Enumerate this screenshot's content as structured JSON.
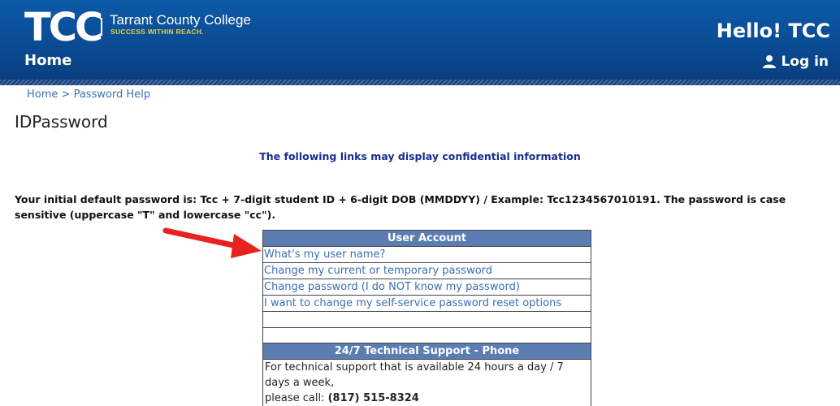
{
  "header": {
    "logo_text": "TCC",
    "college_name": "Tarrant County College",
    "tagline": "SUCCESS WITHIN REACH.",
    "home_label": "Home",
    "greeting": "Hello! TCC",
    "login_label": "Log in"
  },
  "breadcrumb": {
    "home": "Home",
    "separator": ">",
    "current": "Password Help"
  },
  "page_title": "IDPassword",
  "notice": "The following links may display confidential information",
  "password_info": "Your initial default password is: Tcc + 7-digit student ID + 6-digit DOB (MMDDYY) / Example: Tcc1234567010191. The password is case sensitive (uppercase \"T\" and lowercase \"cc\").",
  "user_account": {
    "title": "User Account",
    "links": [
      "What's my user name?",
      "Change my current or temporary password",
      "Change password (I do NOT know my password)",
      "I want to change my self-service password reset options"
    ]
  },
  "support": {
    "title": "24/7 Technical Support - Phone",
    "text_line1": "For technical support that is available 24 hours a day / 7 days a week,",
    "text_line2_prefix": "please call:",
    "phone": "(817) 515-8324"
  },
  "colors": {
    "header_blue": "#0a4a92",
    "panel_header": "#5b7db1",
    "link": "#3a6fb4",
    "notice": "#1a2c8f",
    "annotation_arrow": "#e8231f",
    "tagline": "#e7d23e"
  }
}
